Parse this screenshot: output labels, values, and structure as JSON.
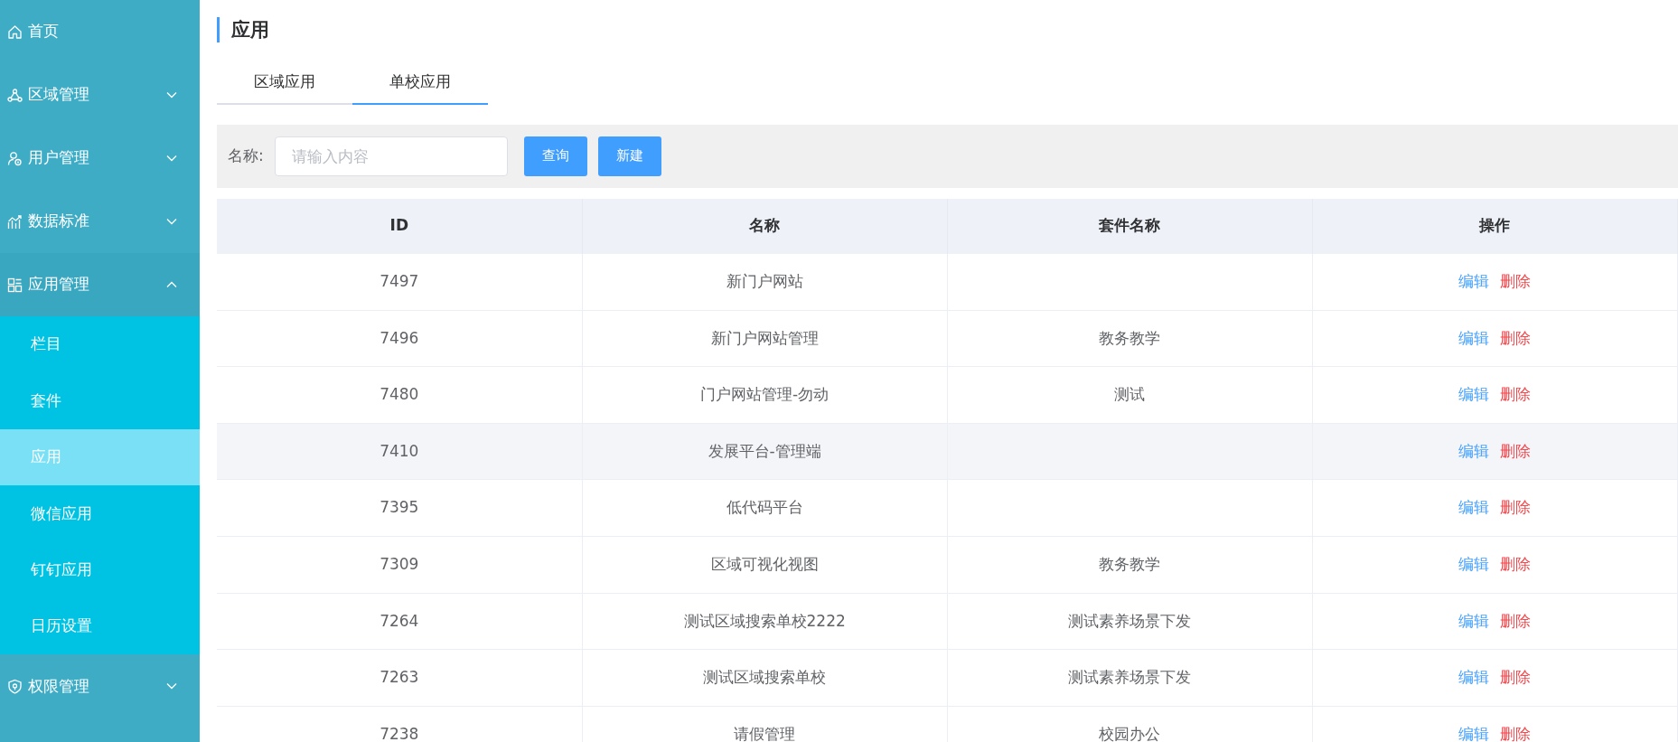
{
  "sidebar": {
    "items": [
      {
        "label": "首页"
      },
      {
        "label": "区域管理",
        "expanded": false
      },
      {
        "label": "用户管理",
        "expanded": false
      },
      {
        "label": "数据标准",
        "expanded": false
      },
      {
        "label": "应用管理",
        "expanded": true,
        "children": [
          {
            "label": "栏目",
            "selected": false
          },
          {
            "label": "套件",
            "selected": false
          },
          {
            "label": "应用",
            "selected": true
          },
          {
            "label": "微信应用",
            "selected": false
          },
          {
            "label": "钉钉应用",
            "selected": false
          },
          {
            "label": "日历设置",
            "selected": false
          }
        ]
      },
      {
        "label": "权限管理",
        "expanded": false
      }
    ]
  },
  "page_title": "应用",
  "tabs": [
    {
      "label": "区域应用",
      "selected": false
    },
    {
      "label": "单校应用",
      "selected": true
    }
  ],
  "search": {
    "label": "名称:",
    "placeholder": "请输入内容",
    "buttons": [
      "查询",
      "新建"
    ]
  },
  "table": {
    "columns": [
      "ID",
      "名称",
      "套件名称",
      "操作"
    ],
    "rows": [
      {
        "id": "7497",
        "name": "新门户网站",
        "suite": "",
        "actions": [
          "编辑",
          "删除"
        ],
        "hovered": false
      },
      {
        "id": "7496",
        "name": "新门户网站管理",
        "suite": "教务教学",
        "actions": [
          "编辑",
          "删除"
        ],
        "hovered": false
      },
      {
        "id": "7480",
        "name": "门户网站管理-勿动",
        "suite": "测试",
        "actions": [
          "编辑",
          "删除"
        ],
        "hovered": false
      },
      {
        "id": "7410",
        "name": "发展平台-管理端",
        "suite": "",
        "actions": [
          "编辑",
          "删除"
        ],
        "hovered": true
      },
      {
        "id": "7395",
        "name": "低代码平台",
        "suite": "",
        "actions": [
          "编辑",
          "删除"
        ],
        "hovered": false
      },
      {
        "id": "7309",
        "name": "区域可视化视图",
        "suite": "教务教学",
        "actions": [
          "编辑",
          "删除"
        ],
        "hovered": false
      },
      {
        "id": "7264",
        "name": "测试区域搜索单校2222",
        "suite": "测试素养场景下发",
        "actions": [
          "编辑",
          "删除"
        ],
        "hovered": false
      },
      {
        "id": "7263",
        "name": "测试区域搜索单校",
        "suite": "测试素养场景下发",
        "actions": [
          "编辑",
          "删除"
        ],
        "hovered": false
      },
      {
        "id": "7238",
        "name": "请假管理",
        "suite": "校园办公",
        "actions": [
          "编辑",
          "删除"
        ],
        "hovered": false
      }
    ]
  }
}
